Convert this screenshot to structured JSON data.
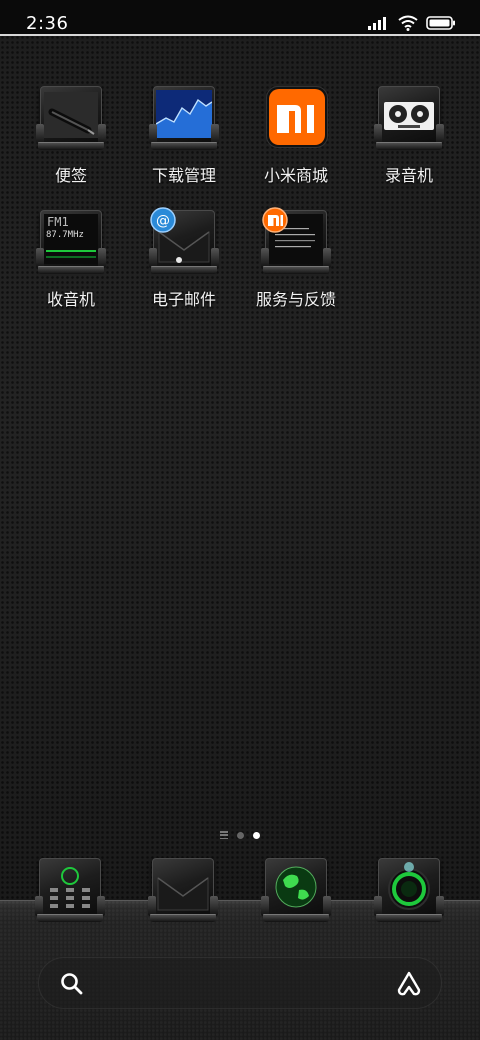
{
  "status_bar": {
    "time": "2:36",
    "icons": [
      "signal-icon",
      "wifi-icon",
      "battery-icon"
    ]
  },
  "home_apps": [
    {
      "label": "便签",
      "icon": "notes-pen-icon"
    },
    {
      "label": "下载管理",
      "icon": "download-chart-icon"
    },
    {
      "label": "小米商城",
      "icon": "mi-logo-icon",
      "text": "MI"
    },
    {
      "label": "录音机",
      "icon": "tape-recorder-icon"
    },
    {
      "label": "收音机",
      "icon": "fm-radio-icon",
      "text": "FM1",
      "text2": "87.7MHz"
    },
    {
      "label": "电子邮件",
      "icon": "email-envelope-icon"
    },
    {
      "label": "服务与反馈",
      "icon": "service-feedback-icon"
    }
  ],
  "dock": [
    {
      "icon": "phone-dialer-icon"
    },
    {
      "icon": "messages-envelope-icon"
    },
    {
      "icon": "browser-globe-icon"
    },
    {
      "icon": "camera-lens-icon"
    }
  ],
  "page_indicator": {
    "pages": 2,
    "active_index": 1
  },
  "search_bar": {
    "icons": [
      "search-icon",
      "assistant-icon"
    ]
  },
  "colors": {
    "mi_orange": "#ff6900",
    "accent_green": "#1ec83c",
    "email_blue": "#2a8ad8"
  }
}
